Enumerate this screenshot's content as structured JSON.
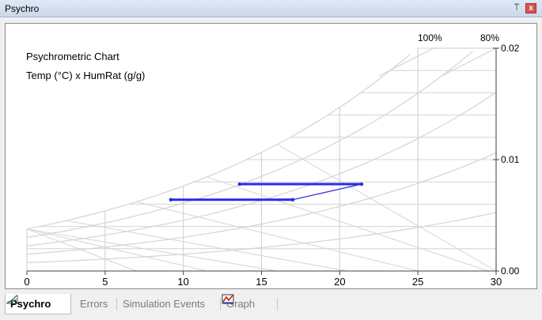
{
  "window": {
    "title": "Psychro",
    "pin_glyph": "⍡",
    "close_glyph": "x"
  },
  "chart": {
    "title_line1": "Psychrometric Chart",
    "title_line2": "Temp (°C) x HumRat (g/g)",
    "rh_labels": [
      "100%",
      "80%"
    ]
  },
  "chart_data": {
    "type": "line",
    "title": "Psychrometric Chart",
    "subtitle": "Temp (°C) x HumRat (g/g)",
    "xlabel": "",
    "ylabel": "",
    "xlim": [
      0,
      30
    ],
    "ylim": [
      0,
      0.02
    ],
    "x_ticks": [
      "0",
      "5",
      "10",
      "15",
      "20",
      "25",
      "30"
    ],
    "y_ticks": [
      "0.00",
      "0.01",
      "0.02"
    ],
    "grid": true,
    "rh_curves": [
      "100%",
      "80%"
    ],
    "series": [
      {
        "color": "#2a2ae8",
        "x": [
          9.2,
          17.0,
          21.4,
          13.6
        ],
        "y": [
          0.0064,
          0.0064,
          0.0078,
          0.0078
        ]
      }
    ]
  },
  "tabs": [
    {
      "label": "Psychro",
      "icon": "psychro-chart-icon",
      "active": true
    },
    {
      "label": "Errors",
      "active": false
    },
    {
      "label": "Simulation Events",
      "active": false
    },
    {
      "label": "Graph",
      "icon": "graph-icon",
      "active": false
    }
  ]
}
